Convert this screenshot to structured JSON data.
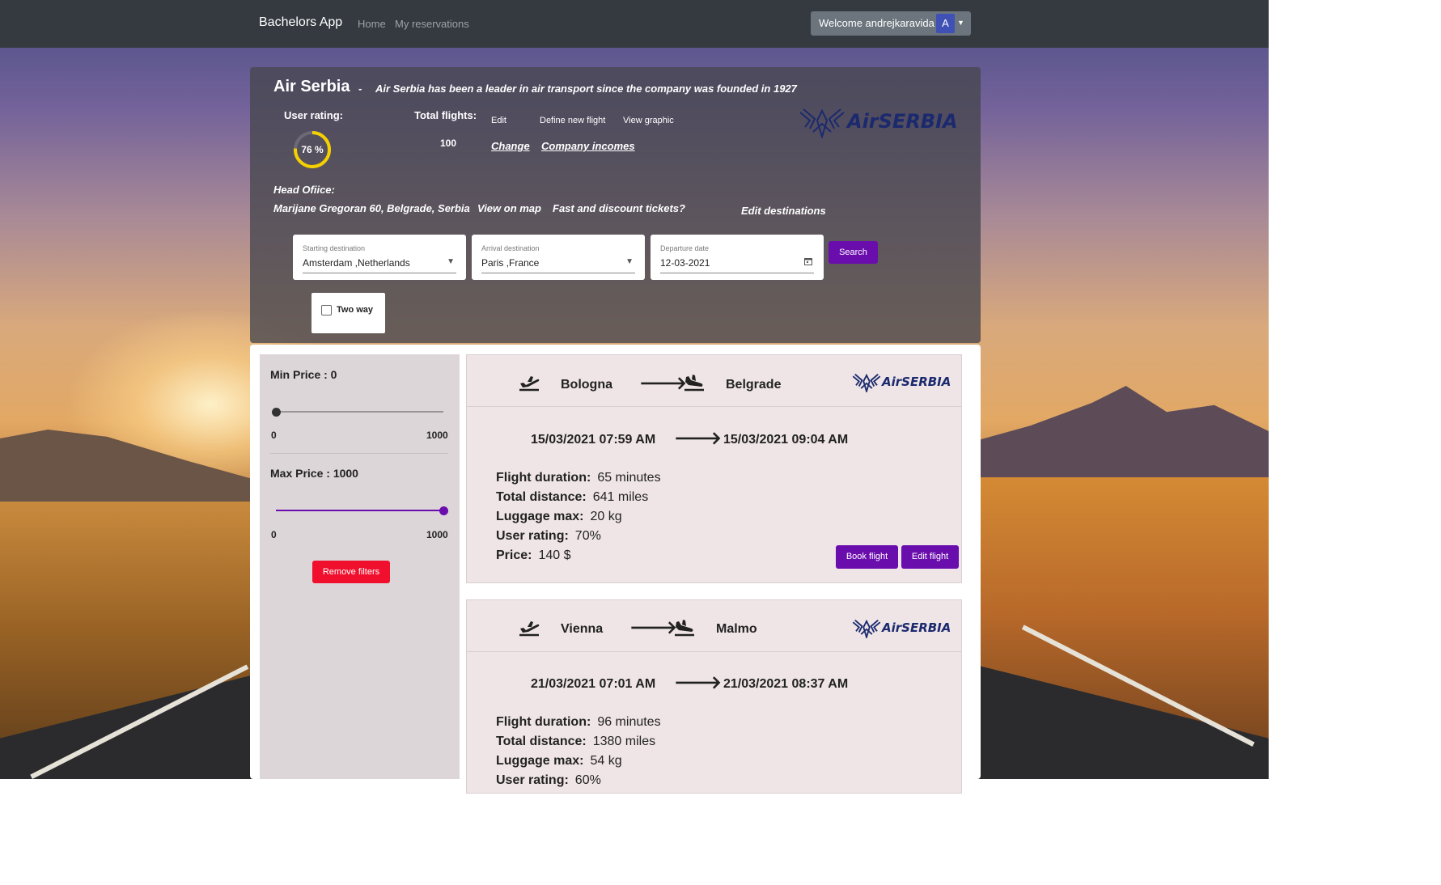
{
  "navbar": {
    "brand": "Bachelors App",
    "links": [
      "Home",
      "My reservations"
    ],
    "welcome": "Welcome andrejkaravida",
    "avatar_letter": "A"
  },
  "company": {
    "name": "Air Serbia",
    "separator": "-",
    "description": "Air Serbia has been a leader in air transport since the company was founded in 1927",
    "user_rating_label": "User rating:",
    "user_rating_value": "76 %",
    "user_rating_fraction": 0.76,
    "total_flights_label": "Total flights:",
    "total_flights_value": "100",
    "actions": {
      "edit": "Edit",
      "define_new_flight": "Define new flight",
      "view_graphic": "View graphic",
      "change": "Change",
      "company_incomes": "Company incomes"
    },
    "logo_text": "AirSERBIA",
    "head_office_label": "Head Ofiice:",
    "head_office_address": "Marijane Gregoran 60, Belgrade, Serbia",
    "view_on_map": "View on map",
    "fast_discount": "Fast and discount tickets?",
    "edit_destinations": "Edit destinations"
  },
  "search": {
    "starting": {
      "label": "Starting destination",
      "value": "Amsterdam ,Netherlands"
    },
    "arrival": {
      "label": "Arrival destination",
      "value": "Paris ,France"
    },
    "departure": {
      "label": "Departure date",
      "value": "12-03-2021"
    },
    "search_button": "Search",
    "two_way_label": "Two way",
    "two_way_checked": false
  },
  "filters": {
    "min_price_title": "Min Price : 0",
    "min_value": 0,
    "min_range_min": "0",
    "min_range_max": "1000",
    "max_price_title": "Max Price : 1000",
    "max_value": 1000,
    "max_range_min": "0",
    "max_range_max": "1000",
    "remove_button": "Remove filters"
  },
  "flights": [
    {
      "from": "Bologna",
      "to": "Belgrade",
      "departure": "15/03/2021 07:59 AM",
      "arrival": "15/03/2021 09:04 AM",
      "duration_label": "Flight duration:",
      "duration": "65 minutes",
      "distance_label": "Total distance:",
      "distance": "641 miles",
      "luggage_label": "Luggage max:",
      "luggage": "20 kg",
      "rating_label": "User rating:",
      "rating": "70%",
      "price_label": "Price:",
      "price": "140 $",
      "book_button": "Book flight",
      "edit_button": "Edit flight"
    },
    {
      "from": "Vienna",
      "to": "Malmo",
      "departure": "21/03/2021 07:01 AM",
      "arrival": "21/03/2021 08:37 AM",
      "duration_label": "Flight duration:",
      "duration": "96 minutes",
      "distance_label": "Total distance:",
      "distance": "1380 miles",
      "luggage_label": "Luggage max:",
      "luggage": "54 kg",
      "rating_label": "User rating:",
      "rating": "60%"
    }
  ],
  "colors": {
    "navbar": "#343a40",
    "accent_purple": "#6a0dad",
    "danger_red": "#f0102e",
    "rating_ring": "#f5d000",
    "logo_blue": "#1b2a6e"
  },
  "icons": {
    "takeoff": "airplane-takeoff-icon",
    "landing": "airplane-landing-icon",
    "arrow": "arrow-right-icon",
    "calendar": "calendar-icon",
    "dropdown": "chevron-down-icon"
  }
}
